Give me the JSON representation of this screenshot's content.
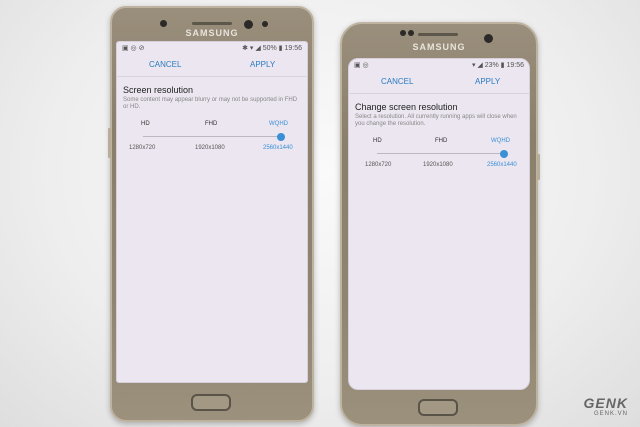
{
  "watermark": {
    "brand": "GENK",
    "site": "GENK.VN"
  },
  "left_phone": {
    "brand": "SAMSUNG",
    "status": {
      "icons": "▣ ◎ ⊘",
      "right": "✱ ▾ ◢ 50% ▮ 19:56"
    },
    "actions": {
      "cancel": "CANCEL",
      "apply": "APPLY"
    },
    "title": "Screen resolution",
    "description": "Some content may appear blurry or may not be supported in FHD or HD.",
    "options": [
      {
        "label": "HD",
        "value": "1280x720"
      },
      {
        "label": "FHD",
        "value": "1920x1080"
      },
      {
        "label": "WQHD",
        "value": "2560x1440"
      }
    ],
    "selected_index": 2
  },
  "right_phone": {
    "brand": "SAMSUNG",
    "status": {
      "icons": "▣ ◎",
      "right": "▾ ◢ 23% ▮ 19:56"
    },
    "actions": {
      "cancel": "CANCEL",
      "apply": "APPLY"
    },
    "title": "Change screen resolution",
    "description": "Select a resolution. All currently running apps will close when you change the resolution.",
    "options": [
      {
        "label": "HD",
        "value": "1280x720"
      },
      {
        "label": "FHD",
        "value": "1920x1080"
      },
      {
        "label": "WQHD",
        "value": "2560x1440"
      }
    ],
    "selected_index": 2
  },
  "colors": {
    "accent": "#3a8fd6",
    "screen_bg": "#ebe6f0",
    "body_gold": "#8e8470"
  }
}
